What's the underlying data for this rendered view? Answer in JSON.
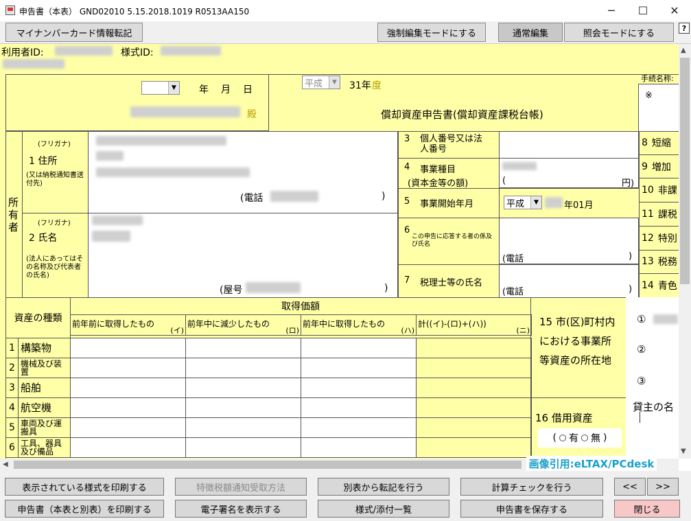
{
  "window": {
    "title": "申告書（本表） GND02010  5.15.2018.1019  R0513AA150",
    "minimize": "─",
    "maximize": "☐",
    "close": "✕"
  },
  "toolbar": {
    "mynumber_button": "マイナンバーカード情報転記",
    "force_edit_button": "強制編集モードにする",
    "normal_edit_button": "通常編集",
    "view_mode_button": "照会モードにする",
    "help": "?"
  },
  "header": {
    "user_id_label": "利用者ID:",
    "form_id_label": "様式ID:",
    "date_year": "年",
    "date_month": "月",
    "date_day": "日",
    "honorific": "殿",
    "era_select": "平成",
    "fiscal_year": "31年",
    "fiscal_suffix": "度",
    "form_title": "償却資産申告書(償却資産課税台帳)",
    "procedure_name_label": "手続名称:",
    "asterisk": "※"
  },
  "owner": {
    "side_label": "所有者",
    "furigana1": "(フリガナ)",
    "address_label": "1  住所",
    "address_note": "(又は納税通知書送付先)",
    "phone1_prefix": "(電話",
    "phone1_suffix": ")",
    "furigana2": "(フリガナ)",
    "name_label": "2  氏名",
    "name_note": "(法人にあってはその名称及び代表者の氏名)",
    "shop_prefix": "(屋号",
    "shop_suffix": ")"
  },
  "middle": {
    "item3_no": "3",
    "item3_label": "個人番号又は法人番号",
    "item4_no": "4",
    "item4_label": "事業種目",
    "item4_sub": "(資本金等の額)",
    "capital_open": "(",
    "capital_unit": "円)",
    "item5_no": "5",
    "item5_label": "事業開始年月",
    "start_era": "平成",
    "start_month": "年01月",
    "item6_no": "6",
    "item6_label": "この申告に応答する者の係及び氏名",
    "phone_prefix": "(電話",
    "phone_suffix": ")",
    "item7_no": "7",
    "item7_label": "税理士等の氏名"
  },
  "right_items": [
    {
      "no": "8",
      "text": "短縮"
    },
    {
      "no": "9",
      "text": "増加"
    },
    {
      "no": "10",
      "text": "非課"
    },
    {
      "no": "11",
      "text": "課税"
    },
    {
      "no": "12",
      "text": "特別"
    },
    {
      "no": "13",
      "text": "税務"
    },
    {
      "no": "14",
      "text": "青色"
    }
  ],
  "asset_table": {
    "type_header": "資産の種類",
    "acquisition_header": "取得価額",
    "columns": [
      {
        "label": "前年前に取得したもの",
        "mark": "(イ)"
      },
      {
        "label": "前年中に減少したもの",
        "mark": "(ロ)"
      },
      {
        "label": "前年中に取得したもの",
        "mark": "(ハ)"
      },
      {
        "label": "計((イ)-(ロ)+(ハ))",
        "mark": "(ニ)"
      }
    ],
    "rows": [
      {
        "no": "1",
        "name": "構築物"
      },
      {
        "no": "2",
        "name": "機械及び装置"
      },
      {
        "no": "3",
        "name": "船舶"
      },
      {
        "no": "4",
        "name": "航空機"
      },
      {
        "no": "5",
        "name": "車両及び運搬具"
      },
      {
        "no": "6",
        "name": "工具、器具及び備品"
      }
    ]
  },
  "location": {
    "label_line1": "15 市(区)町村内",
    "label_line2": "における事業所",
    "label_line3": "等資産の所在地",
    "circle1": "①",
    "circle2": "②",
    "circle3": "③"
  },
  "leased": {
    "label": "16  借用資産",
    "open": "(",
    "yes": "有",
    "no": "無",
    "close": ")",
    "lessor_label": "貸主の名"
  },
  "watermark": "画像引用:eLTAX/PCdesk",
  "bottom_buttons": {
    "print_shown": "表示されている様式を印刷する",
    "special_tax": "特徴税額通知受取方法",
    "transfer": "別表から転記を行う",
    "calc_check": "計算チェックを行う",
    "prev": "<<",
    "next": ">>",
    "print_all": "申告書（本表と別表）を印刷する",
    "show_signature": "電子署名を表示する",
    "attachments": "様式/添付一覧",
    "save": "申告書を保存する",
    "close": "閉じる"
  },
  "colors": {
    "form_bg": "#ffffa8",
    "close_button_bg": "#f8c8c8",
    "watermark": "#1aa0c8"
  }
}
